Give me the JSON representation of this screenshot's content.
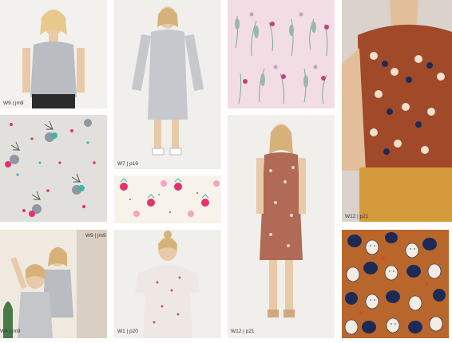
{
  "captions": {
    "tile1": "W9 | jm9",
    "tile2": "W7 | p19",
    "tile4": "W12 | p21",
    "tile5": "W9 | jm9",
    "tile5b": "W4 | jm9",
    "tile6": "W1 | p20",
    "tile7": "W12 | p21"
  },
  "colors": {
    "pink_print_bg": "#f2dde4",
    "grey_print_bg": "#e2e0dd",
    "rust_print_bg": "#b8662c",
    "navy": "#1d2a55"
  }
}
